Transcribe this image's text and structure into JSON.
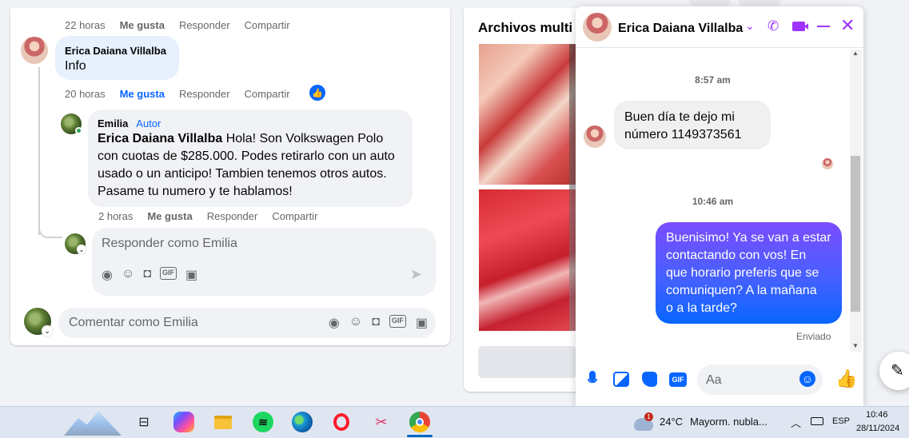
{
  "post": {
    "top_meta": {
      "time": "22 horas",
      "like": "Me gusta",
      "reply": "Responder",
      "share": "Compartir"
    },
    "comment1": {
      "author": "Erica Daiana Villalba",
      "text": "Info"
    },
    "meta1": {
      "time": "20 horas",
      "like": "Me gusta",
      "reply": "Responder",
      "share": "Compartir"
    },
    "reply1": {
      "author": "Emilia",
      "badge": "Autor",
      "mention": "Erica Daiana Villalba",
      "lines": [
        "Hola! Son Volkswagen Polo",
        "con cuotas de $285.000. Podes retirarlo con un auto",
        "usado o un anticipo! Tambien tenemos otros autos.",
        "Pasame tu numero y te hablamos!"
      ]
    },
    "meta2": {
      "time": "2 horas",
      "like": "Me gusta",
      "reply": "Responder",
      "share": "Compartir"
    },
    "reply_box": {
      "placeholder": "Responder como Emilia"
    },
    "comment_box": {
      "placeholder": "Comentar como Emilia"
    }
  },
  "media": {
    "title": "Archivos multi"
  },
  "chat": {
    "name": "Erica Daiana Villalba",
    "time1": "8:57 am",
    "msg1": [
      "Buen día te dejo mi",
      "número 1149373561"
    ],
    "time2": "10:46 am",
    "msg2": [
      "Buenisimo! Ya se van a estar",
      "contactando con vos! En",
      "que horario preferis que se",
      "comuniquen? A la mañana",
      "o a la tarde?"
    ],
    "status": "Enviado",
    "input_placeholder": "Aa",
    "accent": "#0866ff",
    "header_icon_color": "#a033ff"
  },
  "taskbar": {
    "weather_temp": "24°C",
    "weather_text": "Mayorm. nubla...",
    "weather_badge": "1",
    "lang": "ESP",
    "time": "10:46",
    "date": "28/11/2024"
  }
}
